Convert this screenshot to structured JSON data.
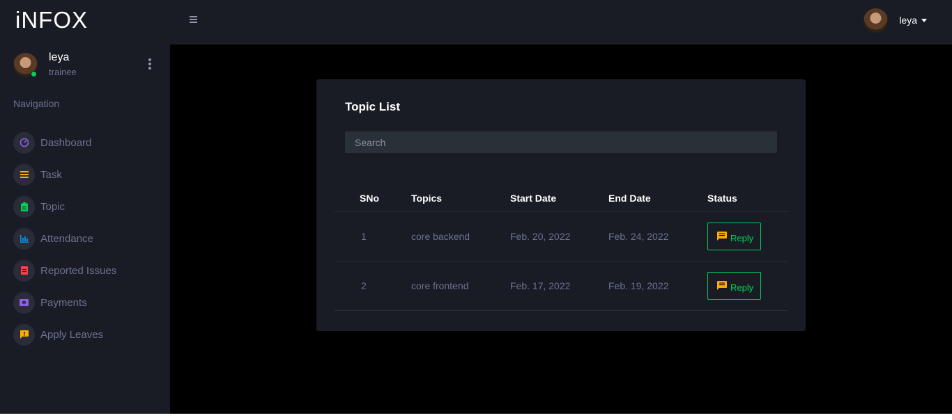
{
  "brand": "iNFOX",
  "topbar": {
    "user_name": "leya"
  },
  "sidebar": {
    "profile": {
      "name": "leya",
      "role": "trainee"
    },
    "heading": "Navigation",
    "items": [
      {
        "label": "Dashboard",
        "icon": "speedometer-icon",
        "color": "#8f5fe8"
      },
      {
        "label": "Task",
        "icon": "list-icon",
        "color": "#ffab00"
      },
      {
        "label": "Topic",
        "icon": "clipboard-icon",
        "color": "#00d25b"
      },
      {
        "label": "Attendance",
        "icon": "bar-chart-icon",
        "color": "#0090e7"
      },
      {
        "label": "Reported Issues",
        "icon": "report-icon",
        "color": "#fc424a"
      },
      {
        "label": "Payments",
        "icon": "cash-icon",
        "color": "#8f5fe8"
      },
      {
        "label": "Apply Leaves",
        "icon": "message-alert-icon",
        "color": "#ffab00"
      }
    ]
  },
  "main": {
    "title": "Topic List",
    "search_placeholder": "Search",
    "table": {
      "headers": [
        "SNo",
        "Topics",
        "Start Date",
        "End Date",
        "Status"
      ],
      "rows": [
        {
          "sno": "1",
          "topic": "core backend",
          "start": "Feb. 20, 2022",
          "end": "Feb. 24, 2022",
          "status": "Reply"
        },
        {
          "sno": "2",
          "topic": "core frontend",
          "start": "Feb. 17, 2022",
          "end": "Feb. 19, 2022",
          "status": "Reply"
        }
      ]
    }
  },
  "colors": {
    "accent_green": "#00d25b",
    "panel": "#191c24",
    "background": "#000000",
    "muted_text": "#6c7293"
  }
}
